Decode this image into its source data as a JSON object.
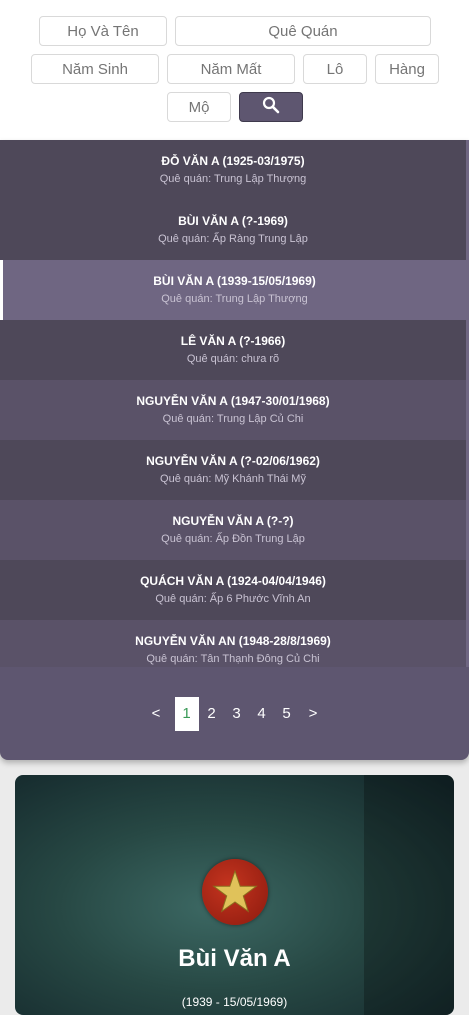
{
  "search": {
    "name_placeholder": "Họ Và Tên",
    "hometown_placeholder": "Quê Quán",
    "birth_year_placeholder": "Năm Sinh",
    "death_year_placeholder": "Năm Mất",
    "plot_placeholder": "Lô",
    "row_placeholder": "Hàng",
    "grave_placeholder": "Mộ",
    "button_icon": "search-icon"
  },
  "list": {
    "hometown_prefix": "Quê quán:",
    "items": [
      {
        "name": "ĐỖ VĂN A (1925-03/1975)",
        "hometown": "Quê quán: Trung Lập Thượng"
      },
      {
        "name": "BÙI VĂN A (?-1969)",
        "hometown": "Quê quán: Ấp Ràng Trung Lập"
      },
      {
        "name": "BÙI VĂN A (1939-15/05/1969)",
        "hometown": "Quê quán: Trung Lập Thượng"
      },
      {
        "name": "LÊ VĂN A (?-1966)",
        "hometown": "Quê quán: chưa rõ"
      },
      {
        "name": "NGUYỄN VĂN A (1947-30/01/1968)",
        "hometown": "Quê quán: Trung Lập Củ Chi"
      },
      {
        "name": "NGUYỄN VĂN A (?-02/06/1962)",
        "hometown": "Quê quán: Mỹ Khánh Thái Mỹ"
      },
      {
        "name": "NGUYỄN VĂN A (?-?)",
        "hometown": "Quê quán: Ấp Đồn Trung Lập"
      },
      {
        "name": "QUÁCH VĂN A (1924-04/04/1946)",
        "hometown": "Quê quán: Ấp 6 Phước Vĩnh An"
      },
      {
        "name": "NGUYỄN VĂN AN (1948-28/8/1969)",
        "hometown": "Quê quán: Tân Thạnh Đông Củ Chi"
      }
    ],
    "selected_index": 2
  },
  "pagination": {
    "prev": "<",
    "pages": [
      "1",
      "2",
      "3",
      "4",
      "5"
    ],
    "current": "1",
    "next": ">"
  },
  "detail": {
    "emblem_icon": "star-emblem-icon",
    "name": "Bùi Văn A",
    "dates": "(1939 - 15/05/1969)"
  },
  "colors": {
    "panel": "#5e5670",
    "row_dark": "#4e4859",
    "row_light": "#5a5268",
    "row_active": "#6f6682",
    "page_active_text": "#3a9a57"
  }
}
